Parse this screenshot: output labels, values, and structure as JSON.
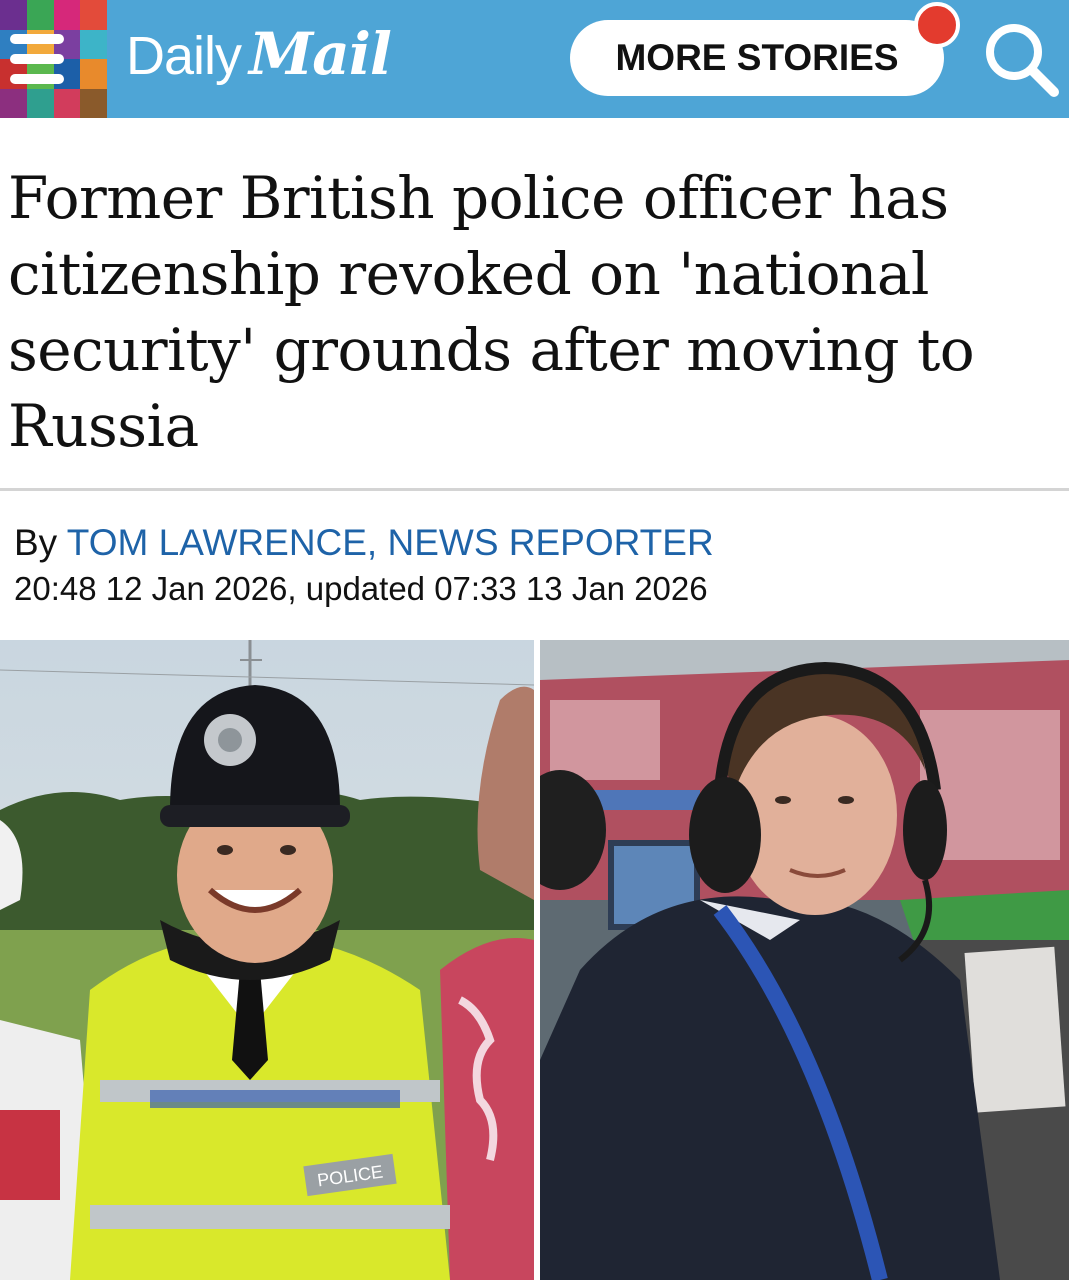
{
  "header": {
    "brand_daily": "Daily",
    "brand_mail": "Mail",
    "more_stories_label": "MORE STORIES",
    "menu_icon": "hamburger-menu-icon",
    "search_icon": "search-icon",
    "notification_color": "#e33b2e",
    "bar_color": "#4ea5d6"
  },
  "article": {
    "headline": "Former British police officer has citizenship revoked on 'national security' grounds after moving to Russia",
    "byline_prefix": "By ",
    "author": "TOM LAWRENCE, NEWS REPORTER",
    "dateline": "20:48 12 Jan 2026, updated 07:33 13 Jan 2026"
  },
  "images": {
    "left": {
      "badge_text": "POLICE"
    },
    "right": {}
  }
}
